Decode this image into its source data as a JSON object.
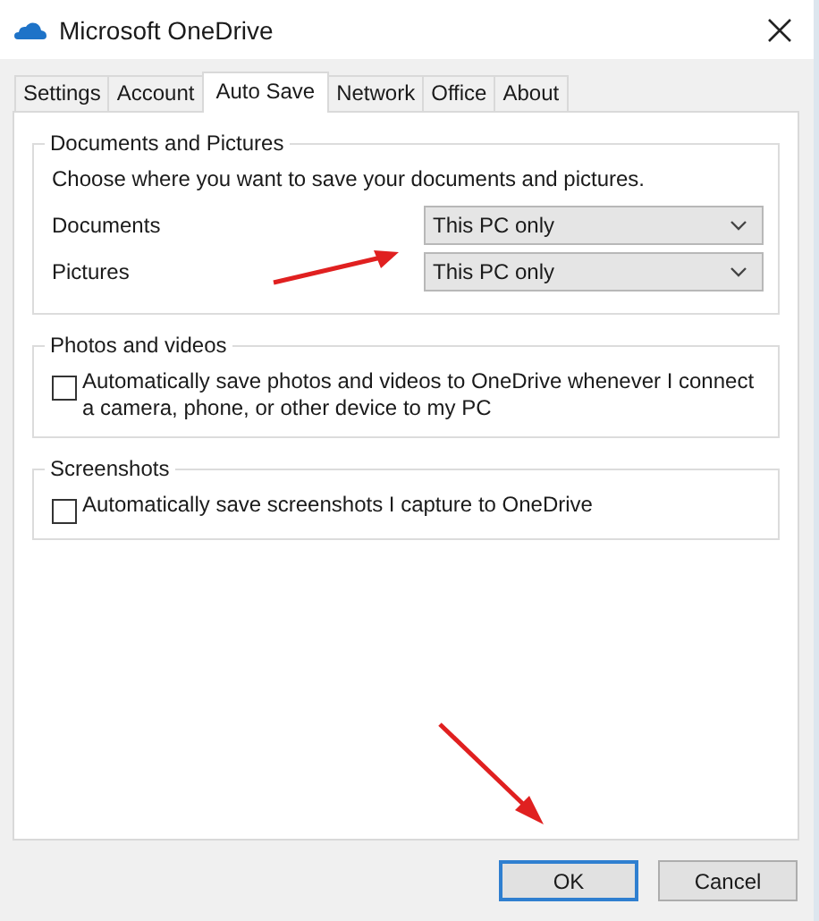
{
  "window": {
    "title": "Microsoft OneDrive"
  },
  "tabs": [
    {
      "label": "Settings",
      "selected": false
    },
    {
      "label": "Account",
      "selected": false
    },
    {
      "label": "Auto Save",
      "selected": true
    },
    {
      "label": "Network",
      "selected": false
    },
    {
      "label": "Office",
      "selected": false
    },
    {
      "label": "About",
      "selected": false
    }
  ],
  "groups": [
    {
      "kind": "locations",
      "title": "Documents and Pictures",
      "description": "Choose where you want to save your documents and pictures.",
      "locations": [
        {
          "label": "Documents",
          "value": "This PC only"
        },
        {
          "label": "Pictures",
          "value": "This PC only"
        }
      ]
    },
    {
      "kind": "checkbox",
      "title": "Photos and videos",
      "label": "Automatically save photos and videos to OneDrive whenever I connect a camera, phone, or other device to my PC",
      "checked": false
    },
    {
      "kind": "checkbox",
      "title": "Screenshots",
      "label": "Automatically save screenshots I capture to OneDrive",
      "checked": false
    }
  ],
  "buttons": [
    {
      "label": "OK",
      "default": true
    },
    {
      "label": "Cancel",
      "default": false
    }
  ]
}
